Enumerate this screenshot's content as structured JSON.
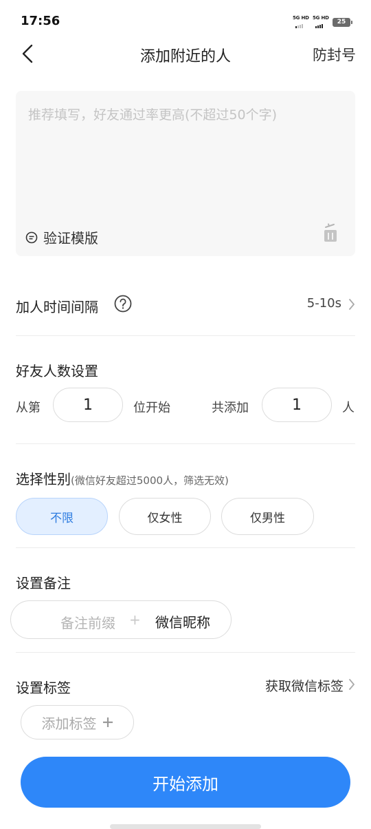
{
  "status_bar": {
    "time": "17:56",
    "sim1_label": "5G HD",
    "sim2_label": "5G HD",
    "battery": "25"
  },
  "nav": {
    "back_icon": "chevron-left-icon",
    "title": "添加附近的人",
    "action": "防封号"
  },
  "message": {
    "placeholder": "推荐填写，好友通过率更高(不超过50个字)",
    "value": "",
    "template_icon": "message-icon",
    "template_label": "验证模版",
    "clear_icon": "trash-icon"
  },
  "interval": {
    "label": "加人时间间隔",
    "help_icon": "question-circle-icon",
    "value": "5-10s"
  },
  "friend_count": {
    "title": "好友人数设置",
    "from_label": "从第",
    "start_value": "1",
    "start_suffix": "位开始",
    "total_label": "共添加",
    "total_value": "1",
    "total_suffix": "人"
  },
  "gender": {
    "title": "选择性别",
    "hint": "(微信好友超过5000人，筛选无效)",
    "options": [
      {
        "label": "不限",
        "selected": true
      },
      {
        "label": "仅女性",
        "selected": false
      },
      {
        "label": "仅男性",
        "selected": false
      }
    ]
  },
  "remark": {
    "title": "设置备注",
    "prefix_placeholder": "备注前缀",
    "plus": "+",
    "nickname": "微信昵称"
  },
  "tags": {
    "title": "设置标签",
    "get_label": "获取微信标签",
    "add_label": "添加标签",
    "add_icon": "plus-icon"
  },
  "start_button": "开始添加",
  "colors": {
    "primary": "#2e87f9",
    "selected_bg": "#e3efff",
    "selected_text": "#2f7de0"
  }
}
